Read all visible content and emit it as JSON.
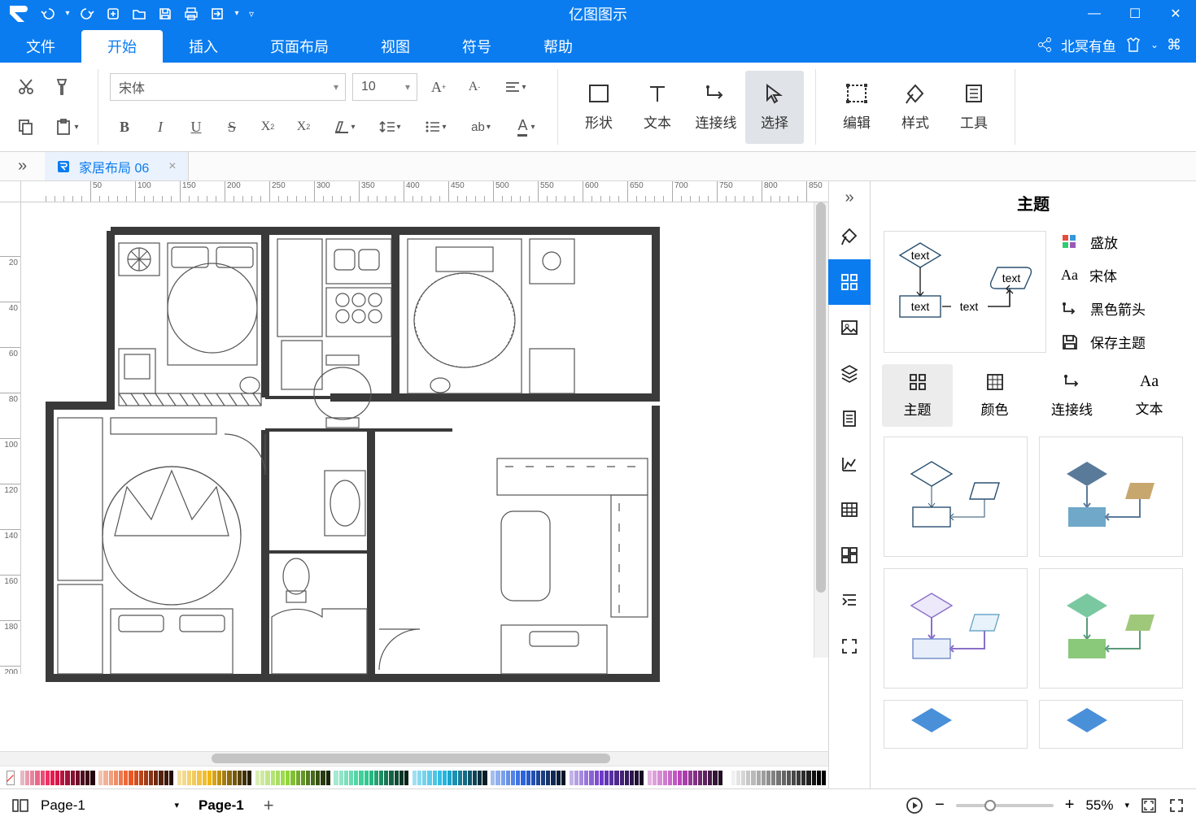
{
  "app_title": "亿图图示",
  "user_name": "北冥有鱼",
  "menu_tabs": [
    "文件",
    "开始",
    "插入",
    "页面布局",
    "视图",
    "符号",
    "帮助"
  ],
  "menu_active": "开始",
  "font_name": "宋体",
  "font_size": "10",
  "tool_labels": {
    "shape": "形状",
    "text": "文本",
    "connector": "连接线",
    "select": "选择",
    "edit": "编辑",
    "style": "样式",
    "tools": "工具"
  },
  "doc_tab": "家居布局 06",
  "ruler_h": [
    50,
    100,
    150,
    200,
    250,
    300,
    350,
    400,
    450,
    500,
    550,
    600,
    650,
    700,
    750,
    800,
    850
  ],
  "ruler_h_sub": [
    0,
    10,
    20,
    30,
    40,
    60,
    70,
    80,
    90,
    110,
    120,
    130,
    140,
    160,
    170,
    180,
    190,
    210,
    220,
    230,
    240,
    260,
    270,
    280,
    290,
    310,
    320,
    330,
    340,
    360,
    370,
    380,
    390,
    410,
    420,
    430,
    440,
    460,
    470,
    480,
    490,
    510,
    520,
    530,
    540,
    560,
    570,
    580,
    590,
    610,
    620,
    630,
    640,
    660,
    670,
    680,
    690,
    710,
    720,
    730,
    740,
    760,
    770,
    780,
    790,
    810,
    820,
    830,
    840
  ],
  "ruler_v": [
    20,
    40,
    60,
    80,
    100,
    120,
    140,
    160,
    180,
    200
  ],
  "page_name": "Page-1",
  "zoom": "55%",
  "theme_panel": {
    "title": "主题",
    "opts": [
      "盛放",
      "宋体",
      "黑色箭头",
      "保存主题"
    ],
    "tabs": [
      "主题",
      "颜色",
      "连接线",
      "文本"
    ],
    "active_tab": "主题",
    "preview_labels": [
      "text",
      "text",
      "text",
      "text"
    ]
  },
  "color_rows": [
    [
      "#e6b8c3",
      "#e79db0",
      "#e8839d",
      "#e96889",
      "#ea4e76",
      "#eb3363",
      "#ec1950",
      "#d21748",
      "#b91440",
      "#a01238",
      "#870f30",
      "#6e0c27",
      "#55091f",
      "#3c0717",
      "#23040f"
    ],
    [
      "#f2c3ae",
      "#f1b196",
      "#f09f7f",
      "#ef8d67",
      "#ee7b50",
      "#ed6938",
      "#ec5721",
      "#d34e1e",
      "#ba451a",
      "#a13c17",
      "#883313",
      "#6f2a10",
      "#56210c",
      "#3d1809",
      "#240f05"
    ],
    [
      "#f6e0a1",
      "#f5d98a",
      "#f4d273",
      "#f3cb5c",
      "#f2c445",
      "#f1bd2e",
      "#f0b617",
      "#d7a315",
      "#be9012",
      "#a57d10",
      "#8c6a0d",
      "#73570b",
      "#5a4408",
      "#413106",
      "#281e04"
    ],
    [
      "#d9eeb4",
      "#cdea9f",
      "#c1e68b",
      "#b5e276",
      "#a9de62",
      "#9dda4d",
      "#91d639",
      "#82c033",
      "#73aa2d",
      "#649427",
      "#557e21",
      "#46681b",
      "#375215",
      "#283c0f",
      "#192609"
    ],
    [
      "#a5e9d2",
      "#91e4c7",
      "#7ddfbc",
      "#69dab1",
      "#55d5a6",
      "#41d09b",
      "#2dcb90",
      "#28b681",
      "#23a172",
      "#1e8c63",
      "#197754",
      "#146245",
      "#0f4d36",
      "#0a3827",
      "#052318"
    ],
    [
      "#9fe0f2",
      "#8ad9ef",
      "#75d2ec",
      "#60cbe9",
      "#4bc4e6",
      "#36bde3",
      "#21b6e0",
      "#1ea3c9",
      "#1a90b2",
      "#177d9b",
      "#136a84",
      "#10576d",
      "#0c4456",
      "#09313f",
      "#051e28"
    ],
    [
      "#a3bef0",
      "#8fafed",
      "#7ba0ea",
      "#6791e7",
      "#5382e4",
      "#3f73e1",
      "#2b64de",
      "#275ac7",
      "#2250b0",
      "#1e4699",
      "#193c82",
      "#15326b",
      "#102854",
      "#0c1e3d",
      "#071426"
    ],
    [
      "#c2b2e8",
      "#b49ee3",
      "#a68ade",
      "#9876d9",
      "#8a62d4",
      "#7c4ecf",
      "#6e3aca",
      "#6334b5",
      "#582ea0",
      "#4d288b",
      "#422276",
      "#371c61",
      "#2c164c",
      "#211037",
      "#160a22"
    ],
    [
      "#e4b2e0",
      "#ddA0da",
      "#d68ed4",
      "#cf7cce",
      "#c86ac8",
      "#c158c2",
      "#ba46bc",
      "#a73fa9",
      "#943896",
      "#813183",
      "#6e2a70",
      "#5b235d",
      "#481c4a",
      "#351537",
      "#220e24"
    ],
    [
      "#ffffff",
      "#f1f1f1",
      "#e3e3e3",
      "#d5d5d5",
      "#c7c7c7",
      "#b9b9b9",
      "#ababab",
      "#9d9d9d",
      "#8f8f8f",
      "#818181",
      "#737373",
      "#656565",
      "#575757",
      "#494949",
      "#3b3b3b",
      "#2d2d2d",
      "#1f1f1f",
      "#111111",
      "#030303",
      "#000000"
    ]
  ]
}
